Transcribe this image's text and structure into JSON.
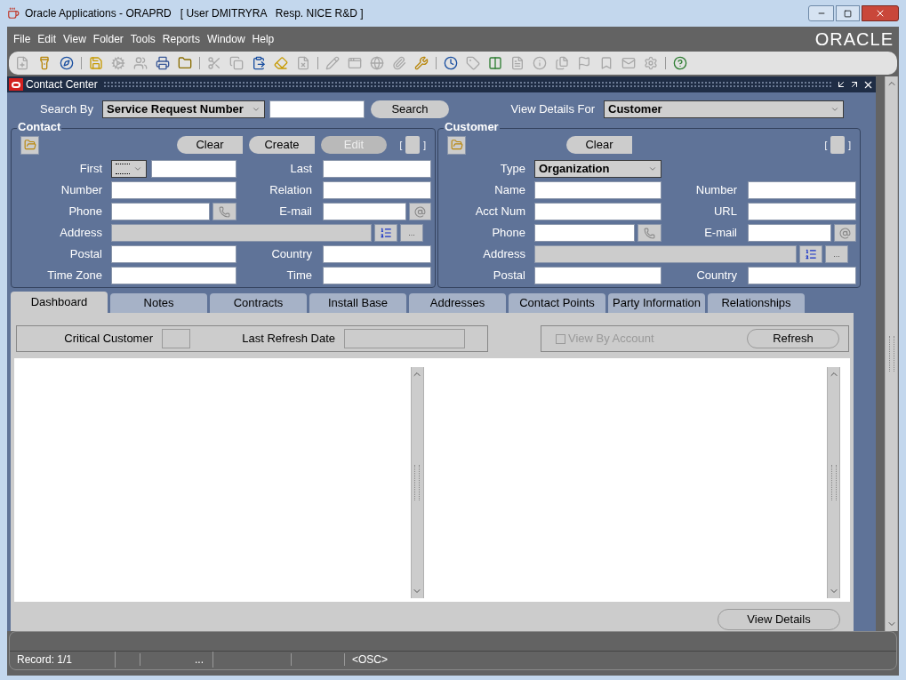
{
  "window": {
    "title": "Oracle Applications - ORAPRD   [ User DMITRYRA   Resp. NICE R&D ]"
  },
  "menu": [
    "File",
    "Edit",
    "View",
    "Folder",
    "Tools",
    "Reports",
    "Window",
    "Help"
  ],
  "logo": "ORACLE",
  "toolbar": [
    {
      "kind": "button",
      "disabled": true
    },
    {
      "kind": "button",
      "disabled": false
    },
    {
      "kind": "button",
      "disabled": false
    },
    {
      "kind": "separator"
    },
    {
      "kind": "button",
      "disabled": false
    },
    {
      "kind": "button",
      "disabled": true
    },
    {
      "kind": "button",
      "disabled": true
    },
    {
      "kind": "button",
      "disabled": false
    },
    {
      "kind": "button",
      "disabled": false
    },
    {
      "kind": "separator"
    },
    {
      "kind": "button",
      "disabled": true
    },
    {
      "kind": "button",
      "disabled": true
    },
    {
      "kind": "button",
      "disabled": false
    },
    {
      "kind": "button",
      "disabled": false
    },
    {
      "kind": "button",
      "disabled": true
    },
    {
      "kind": "separator"
    },
    {
      "kind": "button",
      "disabled": true
    },
    {
      "kind": "button",
      "disabled": true
    },
    {
      "kind": "button",
      "disabled": true
    },
    {
      "kind": "button",
      "disabled": true
    },
    {
      "kind": "button",
      "disabled": false
    },
    {
      "kind": "separator"
    },
    {
      "kind": "button",
      "disabled": false
    },
    {
      "kind": "button",
      "disabled": true
    },
    {
      "kind": "button",
      "disabled": false
    },
    {
      "kind": "button",
      "disabled": true
    },
    {
      "kind": "button",
      "disabled": true
    },
    {
      "kind": "button",
      "disabled": true
    },
    {
      "kind": "button",
      "disabled": true
    },
    {
      "kind": "button",
      "disabled": true
    },
    {
      "kind": "button",
      "disabled": true
    },
    {
      "kind": "button",
      "disabled": true
    },
    {
      "kind": "separator"
    },
    {
      "kind": "button",
      "disabled": false
    }
  ],
  "form": {
    "title": "Contact Center",
    "search_by": {
      "label": "Search By",
      "value": "Service Request Number"
    },
    "search_button": "Search",
    "view_details_for": {
      "label": "View Details For",
      "value": "Customer"
    },
    "contact": {
      "title": "Contact",
      "buttons": [
        {
          "label": "Clear",
          "disabled": false
        },
        {
          "label": "Create",
          "disabled": false
        },
        {
          "label": "Edit",
          "disabled": true
        }
      ],
      "bracket_open": "[",
      "bracket_close": "]",
      "rows": [
        {
          "cells": [
            {
              "label": "First",
              "kind": "prefix"
            },
            {
              "label": "Last",
              "kind": "text"
            }
          ]
        },
        {
          "cells": [
            {
              "label": "Number",
              "kind": "text"
            },
            {
              "label": "Relation",
              "kind": "text"
            }
          ]
        },
        {
          "cells": [
            {
              "label": "Phone",
              "kind": "phone"
            },
            {
              "label": "E-mail",
              "kind": "email"
            }
          ]
        },
        {
          "cells": [
            {
              "label": "Address",
              "kind": "address",
              "button": "..."
            }
          ]
        },
        {
          "cells": [
            {
              "label": "Postal",
              "kind": "text"
            },
            {
              "label": "Country",
              "kind": "text"
            }
          ]
        },
        {
          "cells": [
            {
              "label": "Time Zone",
              "kind": "text"
            },
            {
              "label": "Time",
              "kind": "text"
            }
          ]
        }
      ]
    },
    "customer": {
      "title": "Customer",
      "buttons": [
        {
          "label": "Clear",
          "disabled": false
        }
      ],
      "bracket_open": "[",
      "bracket_close": "]",
      "rows": [
        {
          "cells": [
            {
              "label": "Type",
              "kind": "select",
              "value": "Organization"
            }
          ]
        },
        {
          "cells": [
            {
              "label": "Name",
              "kind": "text"
            },
            {
              "label": "Number",
              "kind": "text"
            }
          ]
        },
        {
          "cells": [
            {
              "label": "Acct Num",
              "kind": "text"
            },
            {
              "label": "URL",
              "kind": "text"
            }
          ]
        },
        {
          "cells": [
            {
              "label": "Phone",
              "kind": "phone"
            },
            {
              "label": "E-mail",
              "kind": "email"
            }
          ]
        },
        {
          "cells": [
            {
              "label": "Address",
              "kind": "address",
              "button": "..."
            }
          ]
        },
        {
          "cells": [
            {
              "label": "Postal",
              "kind": "text"
            },
            {
              "label": "Country",
              "kind": "text"
            }
          ]
        }
      ]
    },
    "tabs": [
      {
        "label": "Dashboard",
        "selected": true
      },
      {
        "label": "Notes",
        "selected": false
      },
      {
        "label": "Contracts",
        "selected": false
      },
      {
        "label": "Install Base",
        "selected": false
      },
      {
        "label": "Addresses",
        "selected": false
      },
      {
        "label": "Contact Points",
        "selected": false
      },
      {
        "label": "Party Information",
        "selected": false
      },
      {
        "label": "Relationships",
        "selected": false
      }
    ],
    "dashboard": {
      "critical_customer": "Critical Customer",
      "last_refresh_date": "Last Refresh Date",
      "view_by_account": {
        "label": "View By Account",
        "checked": false,
        "disabled": true
      },
      "refresh_button": "Refresh",
      "view_details_button": "View Details"
    }
  },
  "status_bar": {
    "record": "Record: 1/1",
    "ellipsis": "...",
    "mode": "<OSC>"
  }
}
